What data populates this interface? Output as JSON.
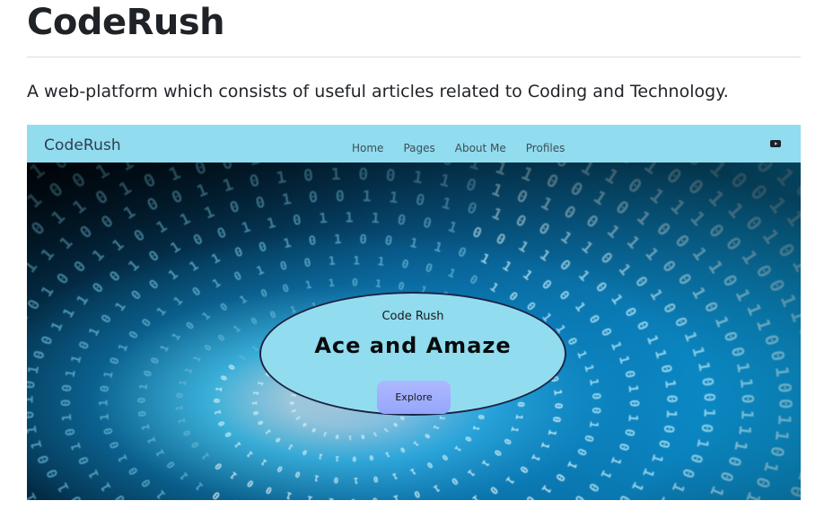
{
  "header": {
    "title": "CodeRush",
    "description": "A web-platform which consists of useful articles related to Coding and Technology."
  },
  "preview": {
    "brand": "CodeRush",
    "nav": [
      "Home",
      "Pages",
      "About Me",
      "Profiles"
    ],
    "icon": "youtube-icon",
    "hero": {
      "small_title": "Code Rush",
      "headline": "Ace and Amaze",
      "button_label": "Explore"
    }
  },
  "colors": {
    "accent": "#91dcee",
    "button": "#a5b3ff",
    "text": "#1f2328",
    "tunnel_dark": "#02131f",
    "tunnel_light": "#5fd2ff"
  }
}
